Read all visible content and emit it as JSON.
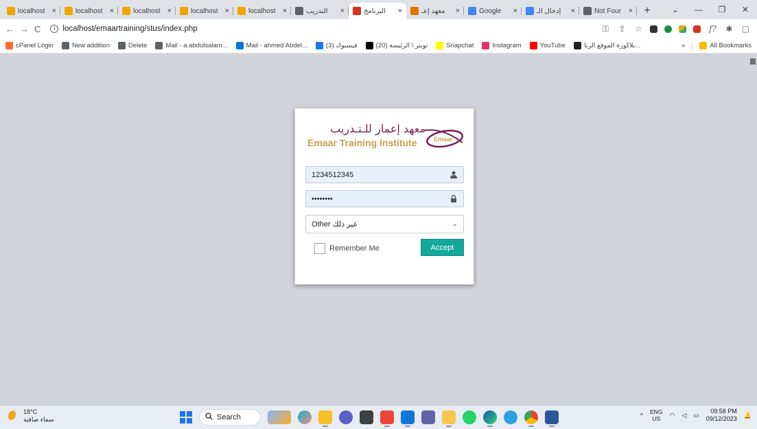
{
  "browser": {
    "tabs": [
      {
        "title": "localhost",
        "favicon_color": "#f0a500",
        "active": false
      },
      {
        "title": "localhost",
        "favicon_color": "#f0a500",
        "active": false
      },
      {
        "title": "localhost",
        "favicon_color": "#f0a500",
        "active": false
      },
      {
        "title": "localhost",
        "favicon_color": "#f0a500",
        "active": false
      },
      {
        "title": "localhost",
        "favicon_color": "#f0a500",
        "active": false
      },
      {
        "title": "التدريب",
        "favicon_color": "#5f6368",
        "active": false
      },
      {
        "title": "البرنامج",
        "favicon_color": "#d93025",
        "active": true
      },
      {
        "title": "معهد إعـ",
        "favicon_color": "#e37400",
        "active": false
      },
      {
        "title": "Google",
        "favicon_color": "#4285f4",
        "active": false
      },
      {
        "title": "إدخال الـ",
        "favicon_color": "#4285f4",
        "active": false
      },
      {
        "title": "Not Four",
        "favicon_color": "#5f6368",
        "active": false
      }
    ],
    "tab_close_glyph": "×",
    "new_tab_glyph": "+",
    "window_controls": {
      "dropdown": "⌄",
      "minimize": "—",
      "restore": "❐",
      "close": "✕"
    },
    "nav": {
      "back": "←",
      "forward": "→",
      "reload": "C"
    },
    "url": "localhost/emaartraining/stus/index.php",
    "bookmarks": [
      {
        "label": "cPanel Login",
        "icon_color": "#ff6c2c"
      },
      {
        "label": "New addition",
        "icon_color": "#5f6368"
      },
      {
        "label": "Delete",
        "icon_color": "#5f6368"
      },
      {
        "label": "Mail - a.abdulsalam...",
        "icon_color": "#5f6368"
      },
      {
        "label": "Mail - ahmed Abdel...",
        "icon_color": "#0078d4"
      },
      {
        "label": "(3) فيسبوك",
        "icon_color": "#1877f2"
      },
      {
        "label": "(20) تويتر \\ الرئيسة",
        "icon_color": "#000000"
      },
      {
        "label": "Snapchat",
        "icon_color": "#fffc00"
      },
      {
        "label": "Instagram",
        "icon_color": "#e1306c"
      },
      {
        "label": "YouTube",
        "icon_color": "#ff0000"
      },
      {
        "label": "بلاكورة الموقع الربا...",
        "icon_color": "#202124"
      }
    ],
    "bookmarks_overflow": "»",
    "all_bookmarks": "All Bookmarks"
  },
  "login": {
    "logo_arabic": "معهد إعمار للـتـدريب",
    "logo_english": "Emaar Training Institute",
    "logo_mark_text": "Emaar",
    "username_value": "1234512345",
    "password_value": "••••••••",
    "select_value": "Other غير ذلك",
    "remember_label": "Remember Me",
    "accept_label": "Accept",
    "accent_color": "#15a99a"
  },
  "taskbar": {
    "weather_temp": "18°C",
    "weather_desc": "سماء صافية",
    "search_label": "Search",
    "lang_top": "ENG",
    "lang_bottom": "US",
    "time": "09:58 PM",
    "date": "09/12/2023",
    "tray_chevron": "^"
  }
}
